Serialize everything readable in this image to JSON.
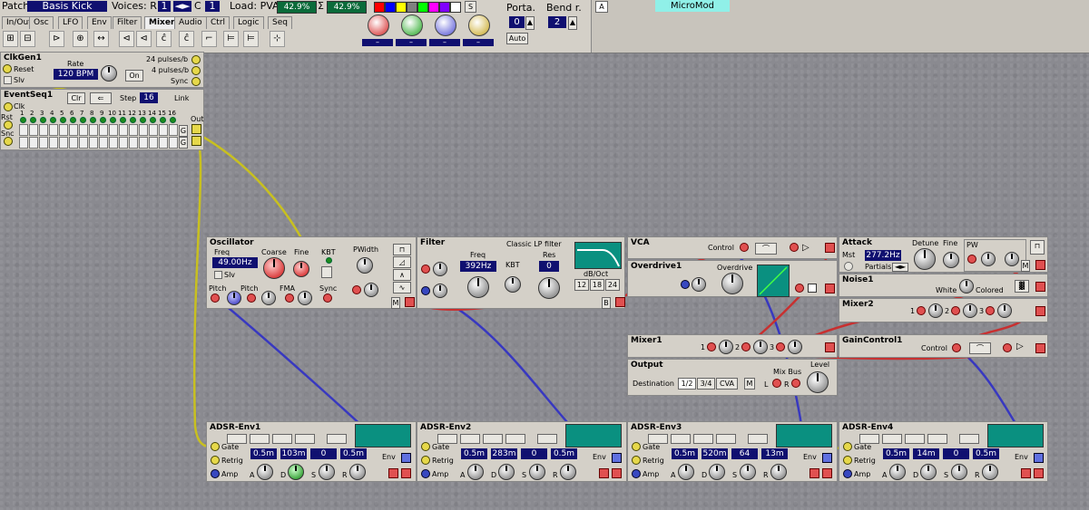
{
  "toolbar": {
    "patch_label": "Patch:",
    "patch_name": "Basis Kick",
    "voices_label": "Voices: R",
    "voices_r": "1",
    "voices_c_label": "C",
    "voices_c": "1",
    "load_label": "Load: PVA",
    "load_pva": "42.9%",
    "load_sigma": "Σ",
    "load_total": "42.9%",
    "s_button": "S",
    "tabs": [
      "In/Out",
      "Osc",
      "LFO",
      "Env",
      "Filter",
      "Mixer",
      "Audio",
      "Ctrl",
      "Logic",
      "Seq"
    ],
    "active_tab": "Mixer",
    "color_swatches": [
      "#ff0000",
      "#0000ff",
      "#ffff00",
      "#808080",
      "#00ff00",
      "#ff00ff",
      "#8000ff",
      "#ffffff"
    ],
    "knob_colors": [
      "#e06060",
      "#60c060",
      "#8080e0",
      "#d8c060"
    ],
    "knob_values": [
      "–",
      "–",
      "–",
      "–"
    ],
    "porta_label": "Porta.",
    "porta_value": "0",
    "auto_label": "Auto",
    "bend_label": "Bend r.",
    "bend_value": "2",
    "slot_label": "A",
    "slot_name": "MicroMod"
  },
  "clkgen": {
    "title": "ClkGen1",
    "reset": "Reset",
    "slv": "Slv",
    "rate_label": "Rate",
    "rate": "120 BPM",
    "on": "On",
    "p24": "24 pulses/b",
    "p4": "4 pulses/b",
    "sync": "Sync"
  },
  "eventseq": {
    "title": "EventSeq1",
    "clr": "Clr",
    "step_label": "Step",
    "step": "16",
    "link": "Link",
    "clk": "Clk",
    "rst": "Rst",
    "snc": "Snc",
    "out": "Out",
    "g": "G",
    "steps": [
      "1",
      "2",
      "3",
      "4",
      "5",
      "6",
      "7",
      "8",
      "9",
      "10",
      "11",
      "12",
      "13",
      "14",
      "15",
      "16"
    ]
  },
  "oscillator": {
    "title": "Oscillator",
    "freq_label": "Freq",
    "freq": "49.00Hz",
    "slv": "Slv",
    "coarse": "Coarse",
    "fine": "Fine",
    "kbt": "KBT",
    "pwidth": "PWidth",
    "sync": "Sync",
    "pitch1": "Pitch",
    "pitch2": "Pitch",
    "fma": "FMA",
    "m": "M"
  },
  "filter": {
    "title": "Filter",
    "subtitle": "Classic LP filter",
    "freq_label": "Freq",
    "freq": "392Hz",
    "kbt": "KBT",
    "res_label": "Res",
    "res": "0",
    "db_label": "dB/Oct",
    "slopes": [
      "12",
      "18",
      "24"
    ],
    "b": "B"
  },
  "vca": {
    "title": "VCA",
    "control": "Control"
  },
  "overdrive": {
    "title": "Overdrive1",
    "knob": "Overdrive"
  },
  "attack": {
    "title": "Attack",
    "mst": "Mst",
    "freq": "277.2Hz",
    "partials": "Partials",
    "detune": "Detune",
    "fine": "Fine",
    "pw": "PW",
    "m": "M"
  },
  "noise": {
    "title": "Noise1",
    "white": "White",
    "colored": "Colored"
  },
  "mixer2": {
    "title": "Mixer2",
    "inputs": [
      "1",
      "2",
      "3"
    ]
  },
  "mixer1": {
    "title": "Mixer1",
    "inputs": [
      "1",
      "2",
      "3"
    ]
  },
  "gaincontrol": {
    "title": "GainControl1",
    "control": "Control"
  },
  "output": {
    "title": "Output",
    "destination": "Destination",
    "dests": [
      "1/2",
      "3/4",
      "CVA"
    ],
    "m": "M",
    "mixbus": "Mix Bus",
    "level": "Level",
    "l": "L",
    "r": "R"
  },
  "envs": [
    {
      "title": "ADSR-Env1",
      "a": "0.5m",
      "d": "103m",
      "s": "0",
      "r": "0.5m"
    },
    {
      "title": "ADSR-Env2",
      "a": "0.5m",
      "d": "283m",
      "s": "0",
      "r": "0.5m"
    },
    {
      "title": "ADSR-Env3",
      "a": "0.5m",
      "d": "520m",
      "s": "64",
      "r": "13m"
    },
    {
      "title": "ADSR-Env4",
      "a": "0.5m",
      "d": "14m",
      "s": "0",
      "r": "0.5m"
    }
  ],
  "env_labels": {
    "gate": "Gate",
    "retrig": "Retrig",
    "amp": "Amp",
    "a": "A",
    "d": "D",
    "s": "S",
    "r": "R",
    "env": "Env"
  }
}
